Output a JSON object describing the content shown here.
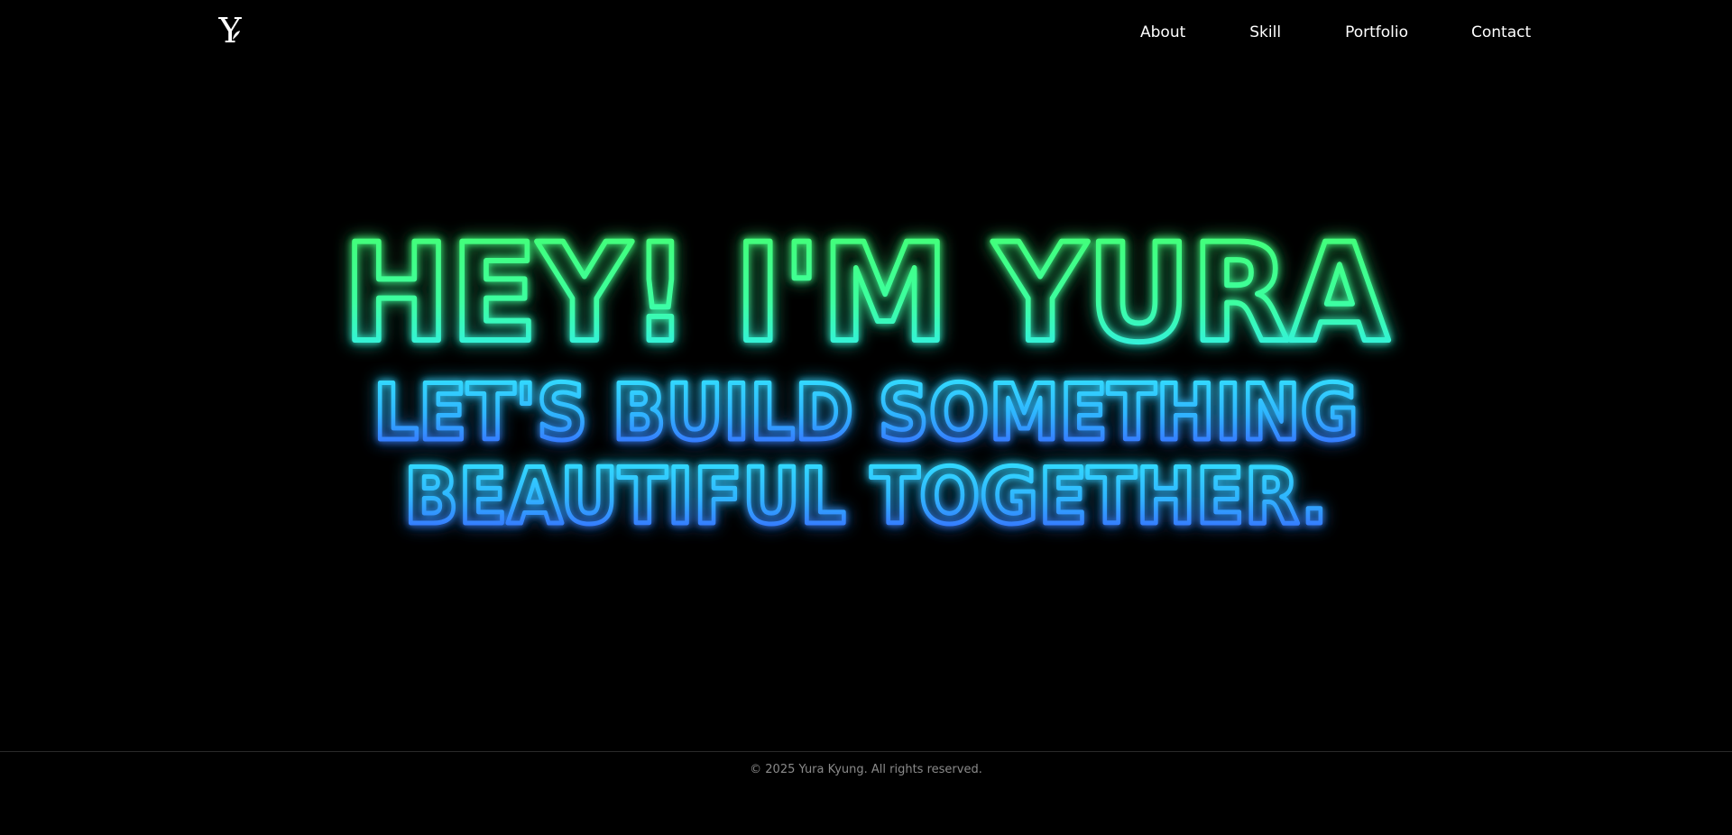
{
  "brand": {
    "logo_letter": "Y"
  },
  "nav": {
    "items": [
      {
        "label": "About"
      },
      {
        "label": "Skill"
      },
      {
        "label": "Portfolio"
      },
      {
        "label": "Contact"
      }
    ]
  },
  "hero": {
    "title": "HEY! I'M YURA",
    "subtitle_line1": "LET'S BUILD SOMETHING",
    "subtitle_line2": "BEAUTIFUL TOGETHER."
  },
  "footer": {
    "copyright": "© 2025 Yura Kyung. All rights reserved."
  },
  "colors": {
    "background": "#000000",
    "neon_green": "#3dff7a",
    "neon_cyan": "#2ef2ff",
    "neon_blue": "#3a6bff",
    "nav_text": "#ffffff",
    "footer_text": "#8a8a8a"
  }
}
